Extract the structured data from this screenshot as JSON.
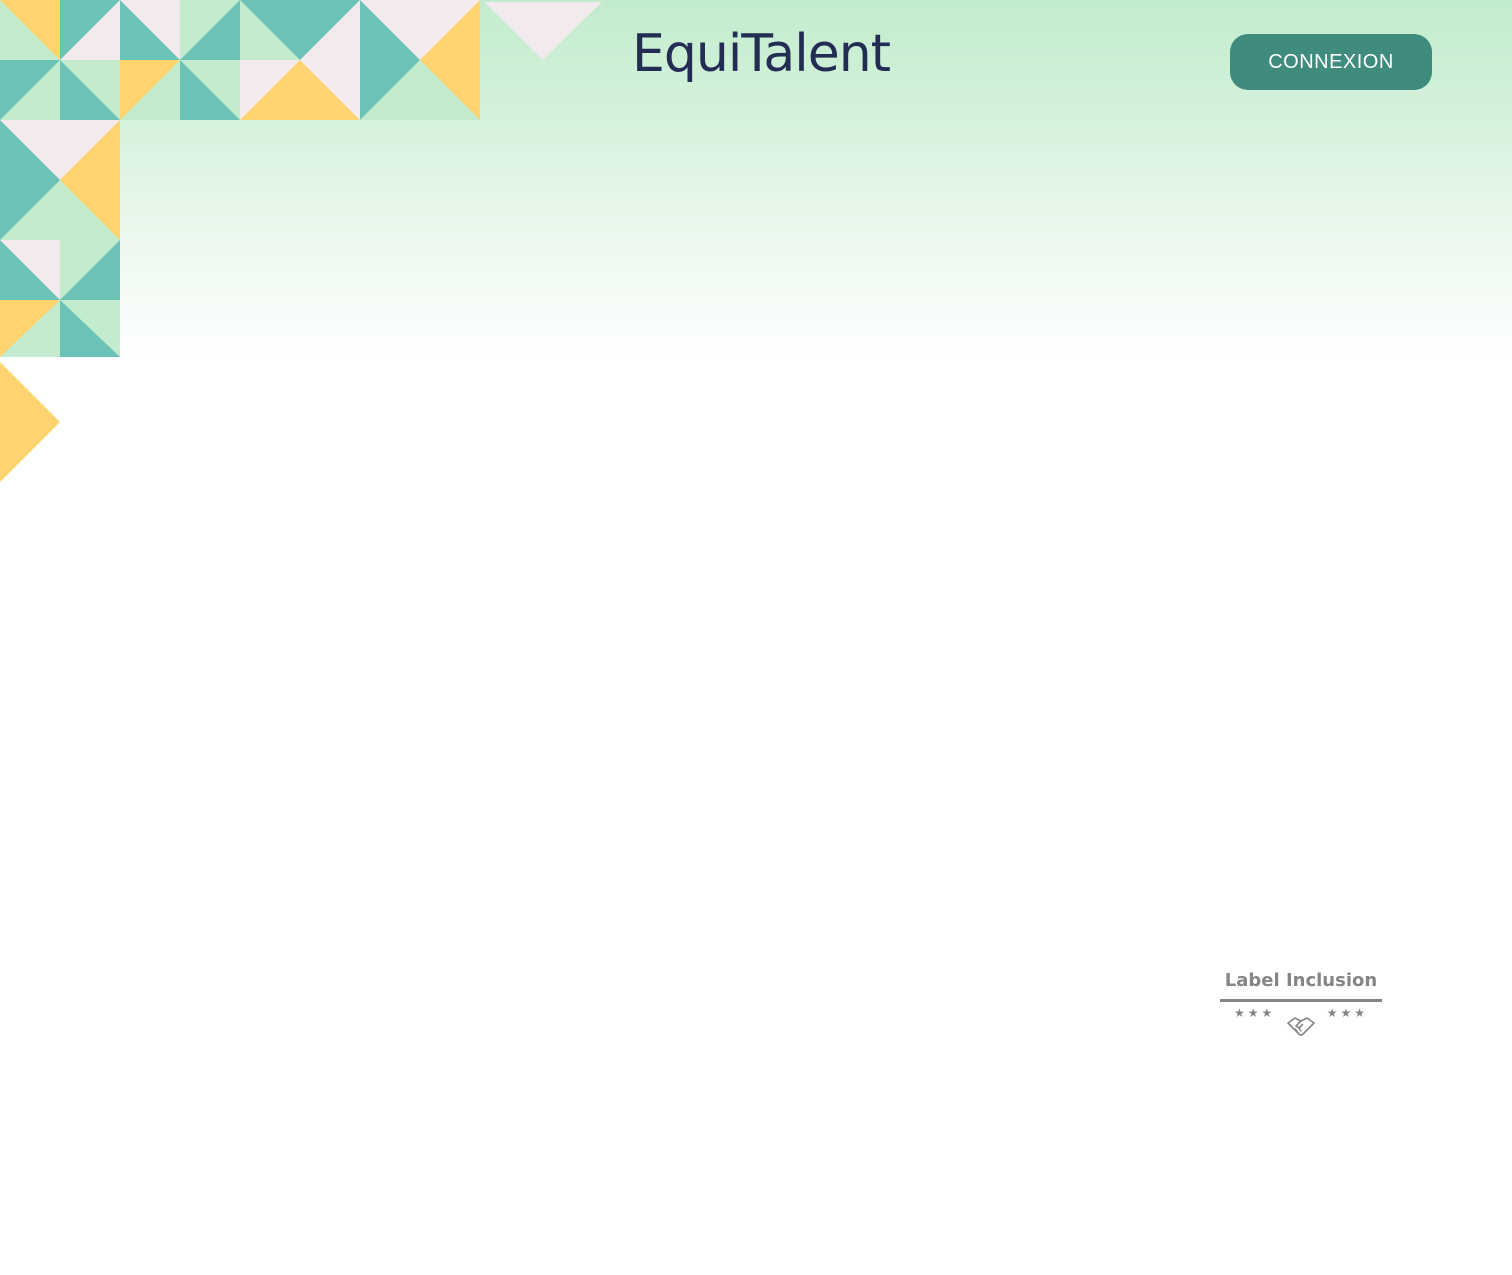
{
  "header": {
    "logo_text": "EquiTalent",
    "login_button_label": "CONNEXION"
  },
  "badge": {
    "title": "Label Inclusion",
    "stars_left": "★★★",
    "stars_right": "★★★",
    "icon": "handshake-icon"
  },
  "decoration": {
    "icon": "geometric-triangle-mosaic",
    "colors": {
      "teal": "#6bc2b6",
      "mint": "#c2eccd",
      "yellow": "#ffd36e",
      "pink": "#f2eaed"
    }
  },
  "theme": {
    "accent": "#3f8b7d",
    "logo_color": "#232c52",
    "badge_gray": "#858585"
  }
}
